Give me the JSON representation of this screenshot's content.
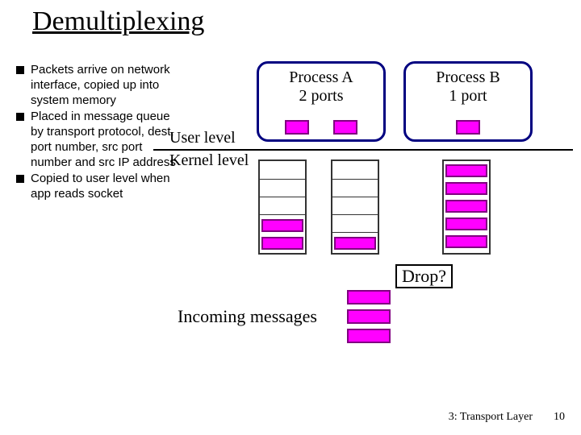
{
  "title": "Demultiplexing",
  "bullets": [
    "Packets arrive on network interface, copied up into system memory",
    "Placed in message queue by transport protocol, dest, port number, src port number and src IP address",
    "Copied to user level when app reads socket"
  ],
  "labels": {
    "user": "User level",
    "kernel": "Kernel level",
    "incoming": "Incoming messages",
    "drop": "Drop?"
  },
  "processes": {
    "a": {
      "name": "Process A",
      "ports_label": "2 ports"
    },
    "b": {
      "name": "Process B",
      "ports_label": "1 port"
    }
  },
  "footer": "3: Transport Layer",
  "page": "10"
}
